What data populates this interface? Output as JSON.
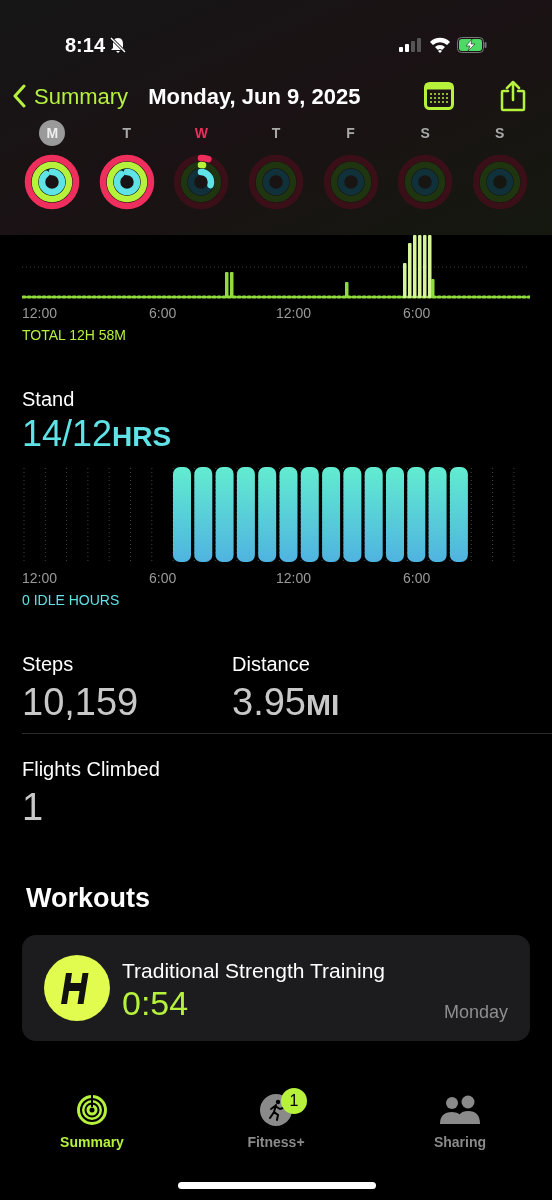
{
  "status_bar": {
    "time": "8:14"
  },
  "nav": {
    "back": "Summary",
    "title": "Monday, Jun 9, 2025"
  },
  "days": [
    {
      "label": "M",
      "selected": true,
      "today": false,
      "kind": "closed"
    },
    {
      "label": "T",
      "selected": false,
      "today": false,
      "kind": "closed"
    },
    {
      "label": "W",
      "selected": false,
      "today": true,
      "kind": "partial"
    },
    {
      "label": "T",
      "selected": false,
      "today": false,
      "kind": "empty"
    },
    {
      "label": "F",
      "selected": false,
      "today": false,
      "kind": "empty"
    },
    {
      "label": "S",
      "selected": false,
      "today": false,
      "kind": "empty"
    },
    {
      "label": "S",
      "selected": false,
      "today": false,
      "kind": "empty"
    }
  ],
  "exercise": {
    "axis": [
      "12:00",
      "6:00",
      "12:00",
      "6:00"
    ],
    "total": "TOTAL 12H 58M"
  },
  "stand": {
    "title": "Stand",
    "value": "14/12",
    "unit": "HRS",
    "axis": [
      "12:00",
      "6:00",
      "12:00",
      "6:00"
    ],
    "idle": "0 IDLE HOURS"
  },
  "stats": [
    {
      "label": "Steps",
      "value": "10,159"
    },
    {
      "label": "Distance",
      "value": "3.95",
      "unit": "MI"
    }
  ],
  "flights": {
    "label": "Flights Climbed",
    "value": "1"
  },
  "workouts": {
    "title": "Workouts",
    "items": [
      {
        "name": "Traditional Strength Training",
        "duration": "0:54",
        "day": "Monday"
      }
    ]
  },
  "tabs": [
    {
      "kind": "summary",
      "label": "Summary",
      "selected": true
    },
    {
      "kind": "fitness",
      "label": "Fitness+",
      "selected": false,
      "badge": "1"
    },
    {
      "kind": "sharing",
      "label": "Sharing",
      "selected": false
    }
  ]
}
